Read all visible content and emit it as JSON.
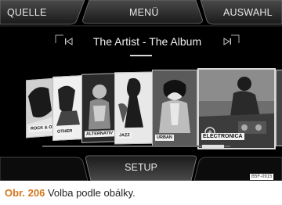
{
  "tabs": {
    "source": "QUELLE",
    "menu": "MENÜ",
    "selection": "AUSWAHL"
  },
  "now_playing": {
    "title": "The Artist - The Album",
    "prev_icon": "skip-back-icon",
    "next_icon": "skip-forward-icon"
  },
  "covers": [
    {
      "label": "ROCK & OT"
    },
    {
      "label": "OTHER"
    },
    {
      "label": "ALTERNATIV"
    },
    {
      "label": "JAZZ"
    },
    {
      "label": "URBAN"
    },
    {
      "label": "ELECTRONICA"
    }
  ],
  "bottom": {
    "setup": "SETUP"
  },
  "ref_code": "B5F-0915",
  "caption": {
    "number": "Obr. 206",
    "text": "Volba podle obálky."
  },
  "colors": {
    "background": "#000000",
    "accent": "#d4771c"
  }
}
